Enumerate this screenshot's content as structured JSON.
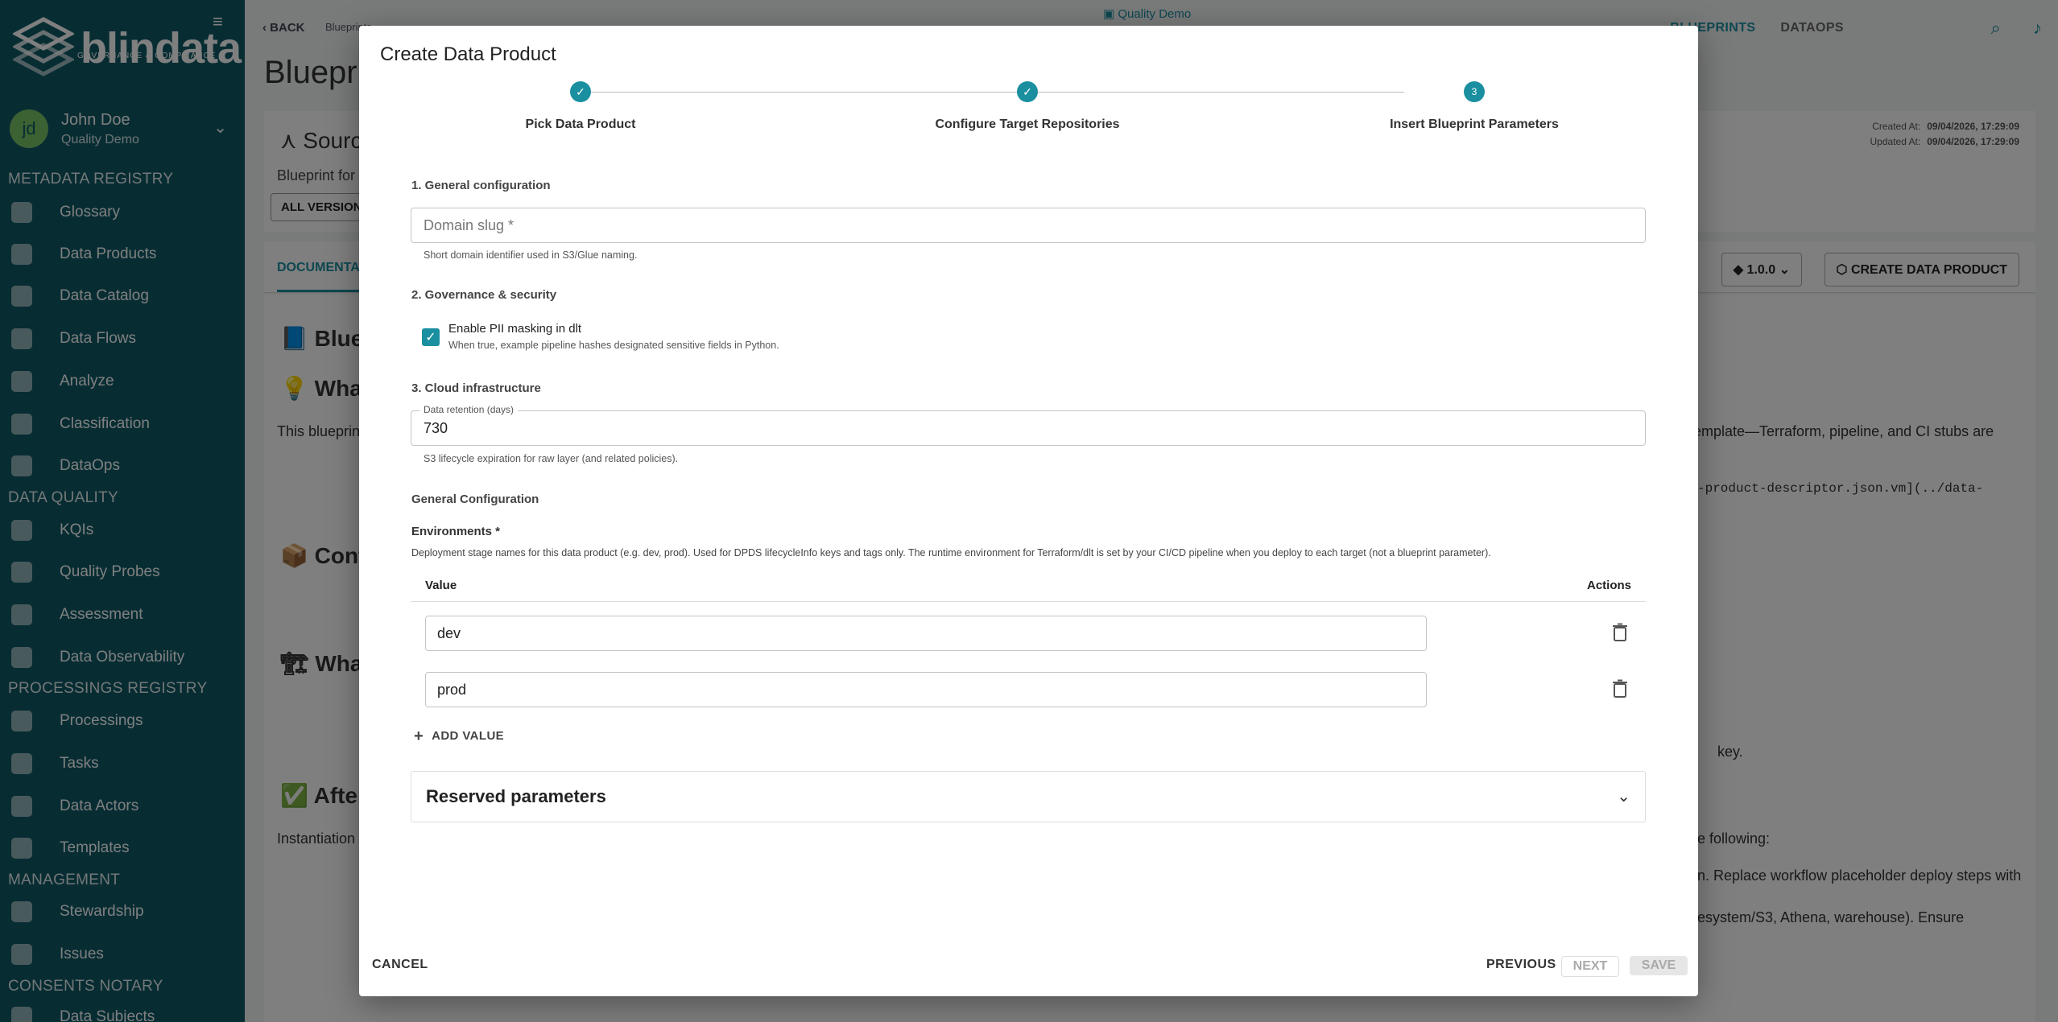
{
  "sidebar": {
    "logo_text": "blindata",
    "logo_tagline": "GOVERNANCE & COMPLIANCE",
    "user": {
      "initials": "jd",
      "name": "John Doe",
      "org": "Quality Demo"
    },
    "sections": [
      {
        "title": "METADATA REGISTRY",
        "items": [
          "Glossary",
          "Data Products",
          "Data Catalog",
          "Data Flows",
          "Analyze",
          "Classification",
          "DataOps"
        ]
      },
      {
        "title": "DATA QUALITY",
        "items": [
          "KQIs",
          "Quality Probes",
          "Assessment",
          "Data Observability"
        ]
      },
      {
        "title": "PROCESSINGS REGISTRY",
        "items": [
          "Processings",
          "Tasks",
          "Data Actors",
          "Templates"
        ]
      },
      {
        "title": "MANAGEMENT",
        "items": [
          "Stewardship",
          "Issues"
        ]
      },
      {
        "title": "CONSENTS NOTARY",
        "items": [
          "Data Subjects"
        ]
      }
    ]
  },
  "topbar": {
    "back_label": "BACK",
    "breadcrumb": "Blueprints",
    "tenant": "Quality Demo",
    "nav": [
      "BLUEPRINTS",
      "DATAOPS"
    ]
  },
  "background": {
    "page_title": "Blueprint",
    "card_title": "Source",
    "card_desc": "Blueprint for",
    "all_versions_button": "ALL VERSIONS",
    "created_label": "Created At:",
    "created_value": "09/04/2026, 17:29:09",
    "updated_label": "Updated At:",
    "updated_value": "09/04/2026, 17:29:09",
    "documentation_tab": "DOCUMENTATION",
    "version_button": "1.0.0",
    "create_button": "CREATE DATA PRODUCT",
    "doc_heading_1": "Blueprint",
    "doc_heading_2": "What",
    "doc_para_1": "This blueprint",
    "doc_heading_3": "Cont",
    "doc_heading_4": "What",
    "doc_heading_5": "After",
    "doc_para_2": "Instantiation",
    "doc_right_1": "template—Terraform, pipeline, and CI stubs are",
    "doc_right_2": "-product-descriptor.json.vm](../data-",
    "doc_right_3": "key.",
    "doc_right_4": "e following:",
    "doc_right_5": "n. Replace workflow placeholder deploy steps with",
    "doc_right_6": "esystem/S3, Athena, warehouse). Ensure"
  },
  "dialog": {
    "title": "Create Data Product",
    "steps": [
      {
        "label": "Pick Data Product",
        "state": "done"
      },
      {
        "label": "Configure Target Repositories",
        "state": "done"
      },
      {
        "label": "Insert Blueprint Parameters",
        "state": "active",
        "number": "3"
      }
    ],
    "general": {
      "heading": "1. General configuration",
      "domain_slug_placeholder": "Domain slug *",
      "domain_slug_value": "",
      "domain_slug_help": "Short domain identifier used in S3/Glue naming."
    },
    "governance": {
      "heading": "2. Governance & security",
      "pii_label": "Enable PII masking in dlt",
      "pii_checked": true,
      "pii_help": "When true, example pipeline hashes designated sensitive fields in Python."
    },
    "cloud": {
      "heading": "3. Cloud infrastructure",
      "retention_label": "Data retention (days)",
      "retention_value": "730",
      "retention_help": "S3 lifecycle expiration for raw layer (and related policies)."
    },
    "general_configuration": {
      "heading": "General Configuration",
      "env_label": "Environments *",
      "env_help": "Deployment stage names for this data product (e.g. dev, prod). Used for DPDS lifecycleInfo keys and tags only. The runtime environment for Terraform/dlt is set by your CI/CD pipeline when you deploy to each target (not a blueprint parameter).",
      "col_value": "Value",
      "col_actions": "Actions",
      "values": [
        "dev",
        "prod"
      ],
      "add_value_label": "ADD VALUE"
    },
    "reserved": {
      "title": "Reserved parameters"
    },
    "footer": {
      "cancel": "CANCEL",
      "previous": "PREVIOUS",
      "next": "NEXT",
      "save": "SAVE"
    }
  },
  "colors": {
    "sidebar_bg": "#0f5a66",
    "accent": "#1a8fa0",
    "avatar": "#79c267"
  }
}
